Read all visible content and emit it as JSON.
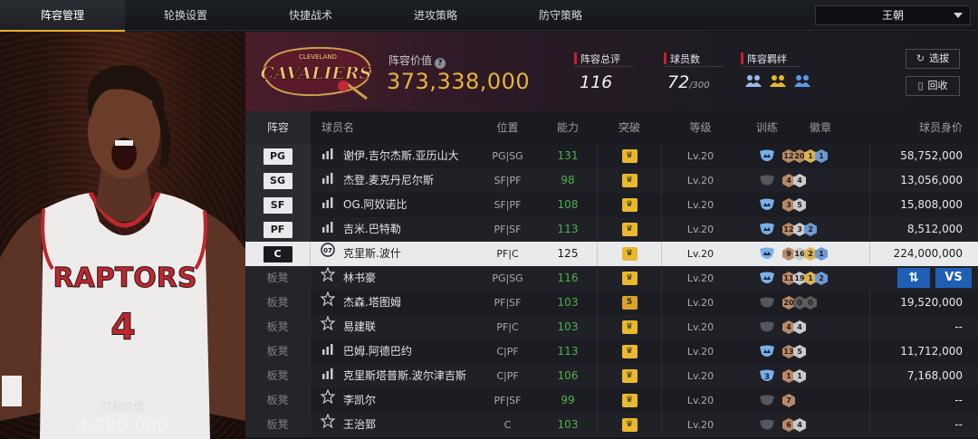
{
  "nav": {
    "tabs": [
      {
        "label": "阵容管理"
      },
      {
        "label": "轮换设置"
      },
      {
        "label": "快捷战术"
      },
      {
        "label": "进攻策略"
      },
      {
        "label": "防守策略"
      }
    ],
    "active_tab": 0,
    "team_select": "王朝"
  },
  "card": {
    "moment_label": "时刻价值",
    "moment_value": "4,280,000",
    "jersey_text": "RAPTORS",
    "jersey_number": "4"
  },
  "summary": {
    "logo_text": "CAVALIERS",
    "logo_subtext": "CLEVELAND",
    "value_label": "阵容价值",
    "value": "373,338,000",
    "total_rating_label": "阵容总评",
    "total_rating": "116",
    "player_count_label": "球员数",
    "player_count": "72",
    "player_count_max": "/300",
    "chemistry_label": "阵容羁绊",
    "select_button": "选拔",
    "recycle_button": "回收"
  },
  "colors": {
    "accent": "#e8b23a",
    "ability_green": "#4bb04c",
    "action_blue": "#1f5fb6",
    "selected_row": "#e9eaec"
  },
  "table": {
    "headers": {
      "lineup": "阵容",
      "name": "球员名",
      "position": "位置",
      "ability": "能力",
      "breakthrough": "突破",
      "level": "等级",
      "training": "训练",
      "badge": "徽章",
      "value": "球员身价"
    },
    "rows": [
      {
        "slot": "PG",
        "name": "谢伊.吉尔杰斯.亚历山大",
        "pos": "PG|SG",
        "ability": "131",
        "brk": "crown",
        "level": "Lv.20",
        "train": "blue",
        "badges": [
          [
            "br",
            "12"
          ],
          [
            "br",
            "20"
          ],
          [
            "gd",
            "1"
          ],
          [
            "bl",
            "1"
          ]
        ],
        "price": "58,752,000"
      },
      {
        "slot": "SG",
        "name": "杰登.麦克丹尼尔斯",
        "pos": "SF|PF",
        "ability": "98",
        "brk": "crown",
        "level": "Lv.20",
        "train": "grey",
        "badges": [
          [
            "br",
            "4"
          ],
          [
            "sv",
            "4"
          ]
        ],
        "price": "13,056,000"
      },
      {
        "slot": "SF",
        "name": "OG.阿奴诺比",
        "pos": "SF|PF",
        "ability": "108",
        "brk": "crown",
        "level": "Lv.20",
        "train": "blue",
        "badges": [
          [
            "br",
            "3"
          ],
          [
            "sv",
            "5"
          ]
        ],
        "price": "15,808,000"
      },
      {
        "slot": "PF",
        "name": "吉米.巴特勒",
        "pos": "PF|SF",
        "ability": "113",
        "brk": "crown",
        "level": "Lv.20",
        "train": "blue",
        "badges": [
          [
            "br",
            "12"
          ],
          [
            "sv",
            "3"
          ],
          [
            "bl",
            "2"
          ]
        ],
        "price": "8,512,000"
      },
      {
        "slot": "C",
        "name": "克里斯.波什",
        "pos": "PF|C",
        "ability": "125",
        "brk": "crown",
        "level": "Lv.20",
        "train": "blue",
        "badges": [
          [
            "br",
            "9"
          ],
          [
            "sv",
            "16"
          ],
          [
            "gd",
            "2"
          ],
          [
            "bl",
            "1"
          ]
        ],
        "price": "224,000,000",
        "selected": true
      },
      {
        "slot": "板凳",
        "name": "林书豪",
        "pos": "PG|SG",
        "ability": "116",
        "brk": "crown",
        "level": "Lv.20",
        "train": "blue",
        "badges": [
          [
            "br",
            "11"
          ],
          [
            "sv",
            "19"
          ],
          [
            "gd",
            "1"
          ],
          [
            "bl",
            "2"
          ]
        ],
        "price": "",
        "actions": true
      },
      {
        "slot": "板凳",
        "name": "杰森.塔图姆",
        "pos": "PF|SF",
        "ability": "103",
        "brk": "5",
        "level": "Lv.20",
        "train": "grey",
        "badges": [
          [
            "br",
            "20"
          ],
          [
            "dk",
            "0"
          ],
          [
            "dk",
            "0"
          ]
        ],
        "price": "19,520,000"
      },
      {
        "slot": "板凳",
        "name": "易建联",
        "pos": "PF|C",
        "ability": "103",
        "brk": "crown",
        "level": "Lv.20",
        "train": "grey",
        "badges": [
          [
            "br",
            "4"
          ],
          [
            "sv",
            "4"
          ]
        ],
        "price": "--"
      },
      {
        "slot": "板凳",
        "name": "巴姆.阿德巴约",
        "pos": "C|PF",
        "ability": "113",
        "brk": "crown",
        "level": "Lv.20",
        "train": "blue",
        "badges": [
          [
            "br",
            "13"
          ],
          [
            "sv",
            "5"
          ]
        ],
        "price": "11,712,000"
      },
      {
        "slot": "板凳",
        "name": "克里斯塔普斯.波尔津吉斯",
        "pos": "C|PF",
        "ability": "106",
        "brk": "crown",
        "level": "Lv.20",
        "train": "blue3",
        "badges": [
          [
            "br",
            "1"
          ],
          [
            "sv",
            "1"
          ]
        ],
        "price": "7,168,000"
      },
      {
        "slot": "板凳",
        "name": "李凯尔",
        "pos": "PF|SF",
        "ability": "99",
        "brk": "crown",
        "level": "Lv.20",
        "train": "grey",
        "badges": [
          [
            "br",
            "7"
          ]
        ],
        "price": "--"
      },
      {
        "slot": "板凳",
        "name": "王治郅",
        "pos": "C",
        "ability": "103",
        "brk": "crown",
        "level": "Lv.20",
        "train": "grey",
        "badges": [
          [
            "br",
            "6"
          ],
          [
            "sv",
            "4"
          ]
        ],
        "price": "--"
      }
    ]
  }
}
